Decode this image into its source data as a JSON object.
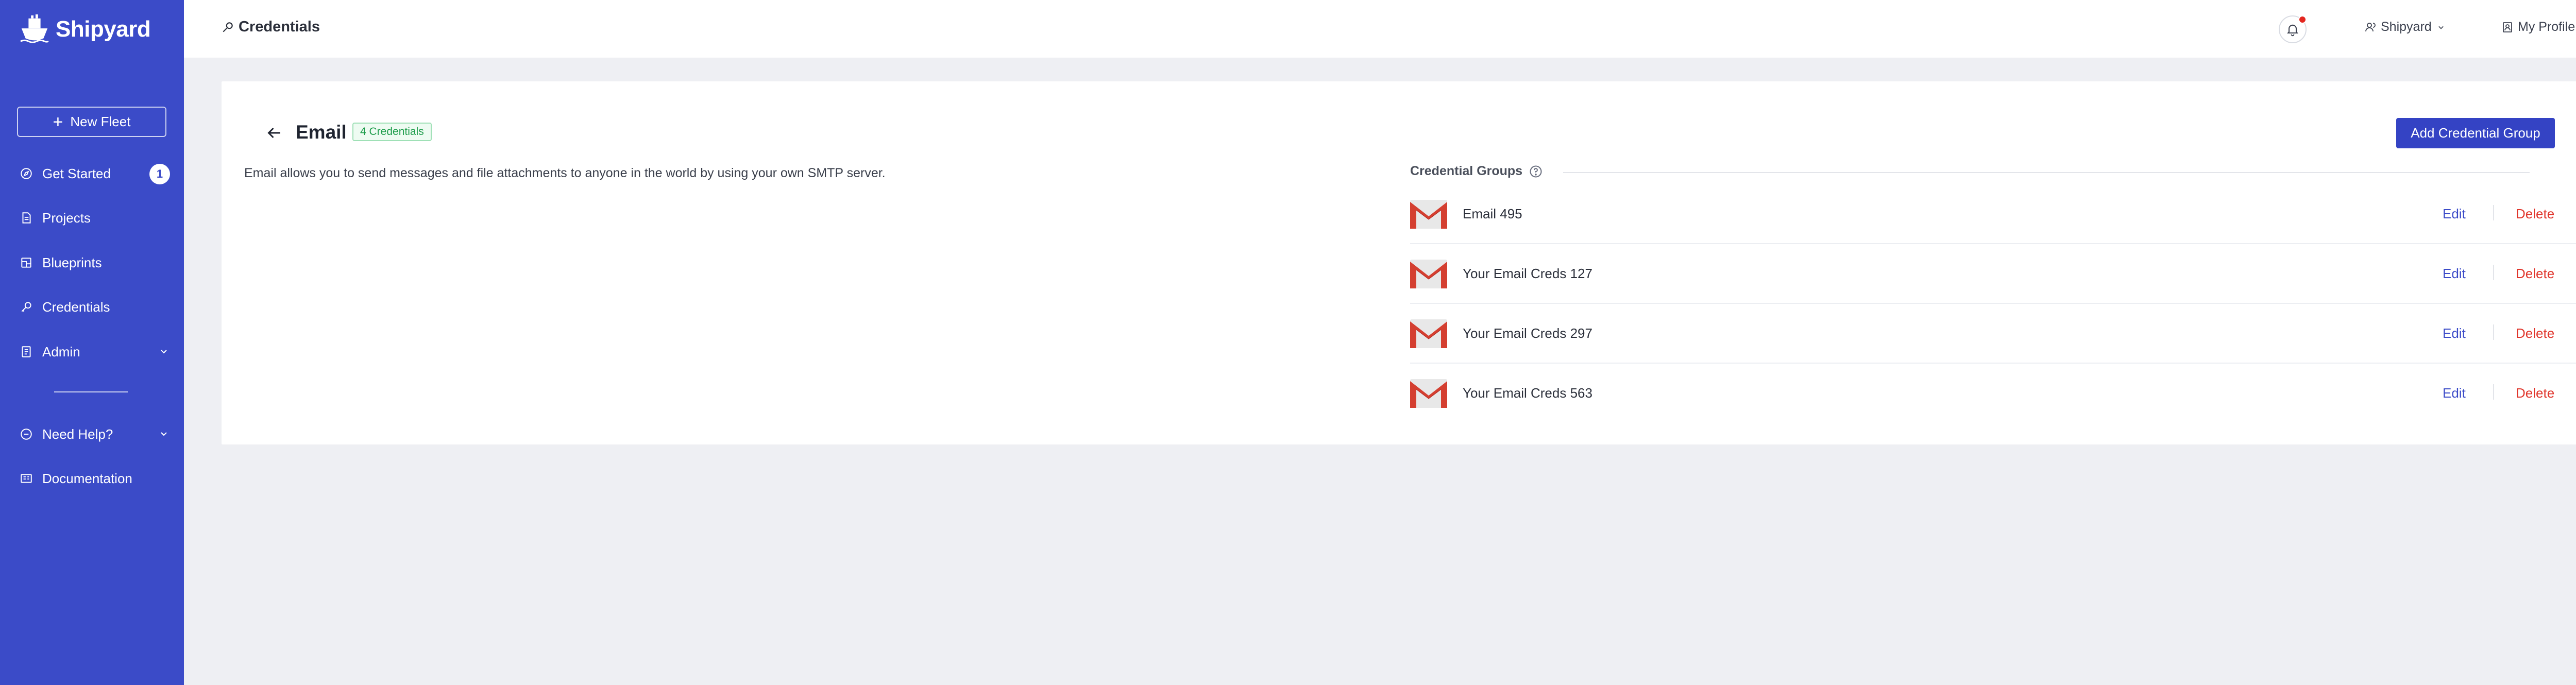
{
  "app": {
    "name": "Shipyard"
  },
  "sidebar": {
    "new_fleet_label": "New Fleet",
    "items": [
      {
        "label": "Get Started",
        "badge": "1",
        "icon": "compass-icon"
      },
      {
        "label": "Projects",
        "icon": "document-icon"
      },
      {
        "label": "Blueprints",
        "icon": "blueprint-icon"
      },
      {
        "label": "Credentials",
        "icon": "key-icon"
      },
      {
        "label": "Admin",
        "icon": "admin-icon"
      },
      {
        "label": "Need Help?",
        "icon": "help-icon"
      },
      {
        "label": "Documentation",
        "icon": "book-icon"
      }
    ]
  },
  "header": {
    "title": "Credentials",
    "org_label": "Shipyard",
    "profile_label": "My Profile"
  },
  "page": {
    "title": "Email",
    "badge": "4 Credentials",
    "add_button": "Add Credential Group",
    "description": "Email allows you to send messages and file attachments to anyone in the world by using your own SMTP server.",
    "groups_header": "Credential Groups",
    "groups": [
      {
        "name": "Email 495",
        "edit": "Edit",
        "delete": "Delete"
      },
      {
        "name": "Your Email Creds 127",
        "edit": "Edit",
        "delete": "Delete"
      },
      {
        "name": "Your Email Creds 297",
        "edit": "Edit",
        "delete": "Delete"
      },
      {
        "name": "Your Email Creds 563",
        "edit": "Edit",
        "delete": "Delete"
      }
    ]
  },
  "colors": {
    "sidebar": "#3b4bc8",
    "primary_button": "#3443c4",
    "delete": "#e0352b",
    "badge_green": "#1f9d4c",
    "notification": "#e3261f"
  }
}
